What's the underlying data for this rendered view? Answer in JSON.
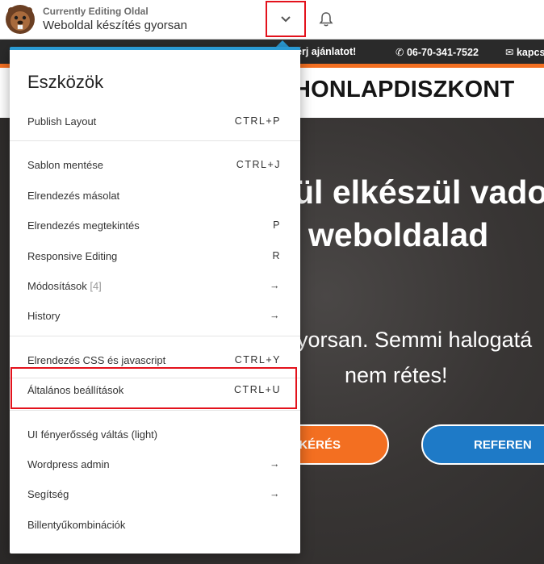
{
  "topbar": {
    "editing_label": "Currently Editing Oldal",
    "page_title": "Weboldal készítés gyorsan",
    "logo_icon": "beaver-logo-icon",
    "toggle_icon": "chevron-down-icon",
    "bell_icon": "bell-icon"
  },
  "site": {
    "topline": [
      "et, kérj ajánlatot!",
      "06-70-341-7522",
      "kapcs"
    ],
    "brand": "HONLAPDISZKONT",
    "hero_line1": "ül elkészül vado",
    "hero_line2": "weboldalad",
    "hero_sub1": "yorsan. Semmi halogatá",
    "hero_sub2": "nem rétes!",
    "btn_orange": "KÉRÉS",
    "btn_blue": "REFEREN",
    "accent_orange": "#f36f21",
    "accent_blue": "#1e7ac7"
  },
  "menu": {
    "heading": "Eszközök",
    "accent": "#2a9ad3",
    "items": [
      {
        "label": "Publish Layout",
        "shortcut": "CTRL+P"
      },
      {
        "label": "Sablon mentése",
        "shortcut": "CTRL+J"
      },
      {
        "label": "Elrendezés másolat",
        "shortcut": ""
      },
      {
        "label": "Elrendezés megtekintés",
        "shortcut": "P"
      },
      {
        "label": "Responsive Editing",
        "shortcut": "R"
      },
      {
        "label": "Módosítások",
        "count": "[4]",
        "shortcut": "→"
      },
      {
        "label": "History",
        "shortcut": "→"
      },
      {
        "label": "Elrendezés CSS és javascript",
        "shortcut": "CTRL+Y"
      },
      {
        "label": "Általános beállítások",
        "shortcut": "CTRL+U"
      },
      {
        "label": "UI fényerősség váltás (light)",
        "shortcut": ""
      },
      {
        "label": "Wordpress admin",
        "shortcut": "→"
      },
      {
        "label": "Segítség",
        "shortcut": "→"
      },
      {
        "label": "Billentyűkombinációk",
        "shortcut": ""
      }
    ]
  }
}
